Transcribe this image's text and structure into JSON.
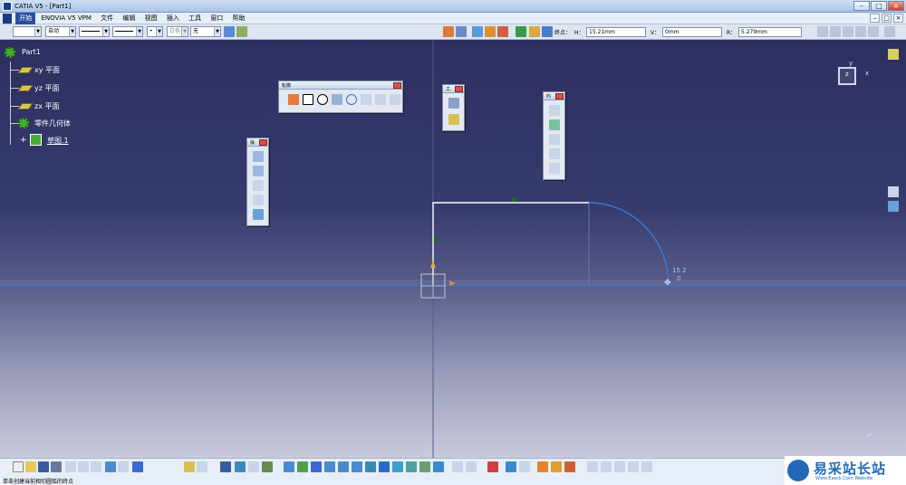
{
  "window": {
    "title": "CATIA V5 - [Part1]"
  },
  "menubar": {
    "items": [
      "开始",
      "ENOVIA V5 VPM",
      "文件",
      "编辑",
      "视图",
      "插入",
      "工具",
      "窗口",
      "帮助"
    ]
  },
  "toolbar": {
    "dropdowns": [
      "",
      "自动",
      "",
      "",
      "",
      "",
      "无"
    ],
    "dropdown_default_label": "白色",
    "endpoint_label": "终点：",
    "h_label": "H：",
    "h_value": "15.21mm",
    "v_label": "V：",
    "v_value": "0mm",
    "r_label": "R：",
    "r_value": "5.279mm"
  },
  "tree": {
    "root": "Part1",
    "items": [
      {
        "label": "xy 平面",
        "icon": "plane-icon"
      },
      {
        "label": "yz 平面",
        "icon": "plane-icon"
      },
      {
        "label": "zx 平面",
        "icon": "plane-icon"
      },
      {
        "label": "零件几何体",
        "icon": "body-icon"
      },
      {
        "label": "草图.1",
        "icon": "sketch-icon"
      }
    ]
  },
  "palettes": {
    "profile": {
      "title": "轮廓"
    },
    "ops": {
      "title": "操"
    },
    "small": {
      "title": "工"
    },
    "constraint": {
      "title": "约"
    }
  },
  "sketch": {
    "dim_value": "15.2",
    "dim_sub": "0"
  },
  "axis": {
    "x": "x",
    "y": "y",
    "z": "z"
  },
  "status": {
    "text": "单击创建当前相切圆弧的终点"
  },
  "watermark": {
    "title": "易采站长站",
    "subtitle": "Www.Easck.Com Website"
  },
  "colors": {
    "accent": "#2b4fa0",
    "sketch_arc": "#3a7bd5",
    "sketch_line": "#ffffff"
  }
}
